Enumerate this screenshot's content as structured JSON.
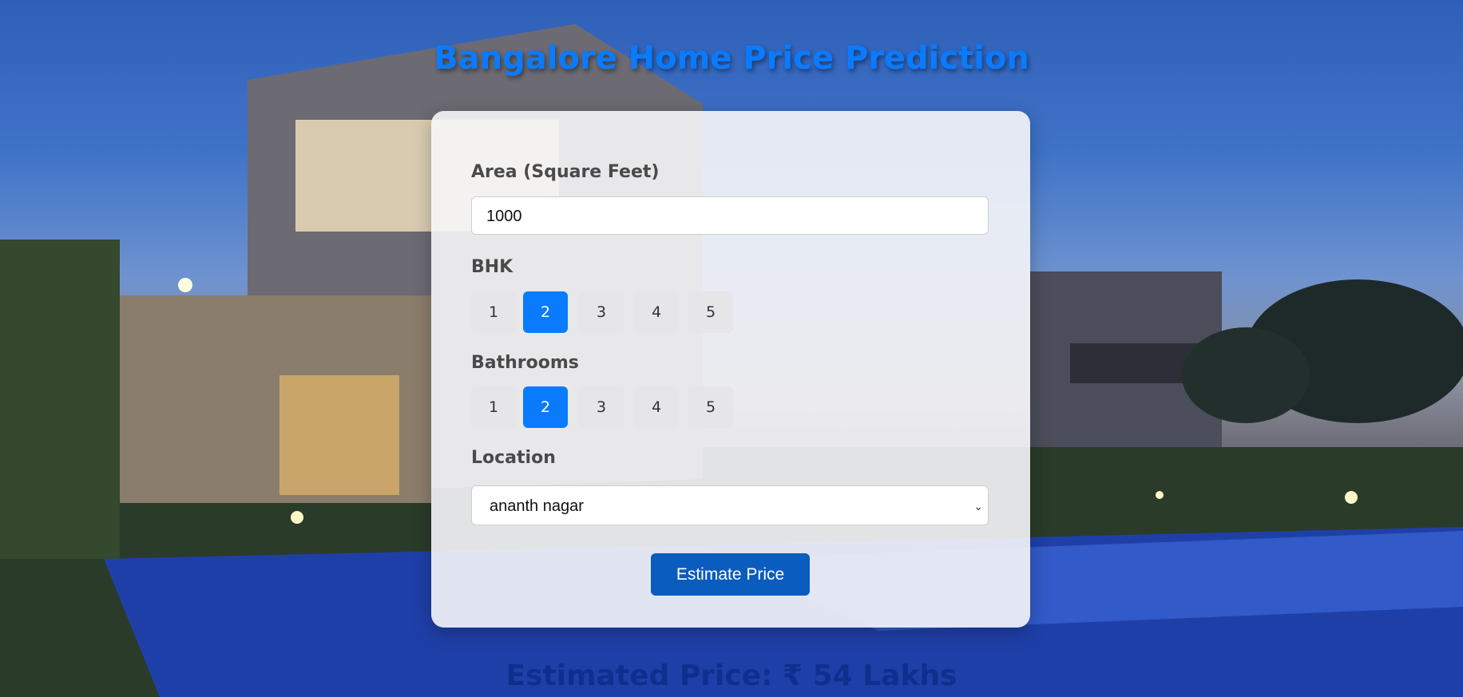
{
  "page": {
    "title": "Bangalore Home Price Prediction"
  },
  "form": {
    "area_label": "Area (Square Feet)",
    "area_value": "1000",
    "bhk_label": "BHK",
    "bhk_options": [
      "1",
      "2",
      "3",
      "4",
      "5"
    ],
    "bhk_selected": "2",
    "bath_label": "Bathrooms",
    "bath_options": [
      "1",
      "2",
      "3",
      "4",
      "5"
    ],
    "bath_selected": "2",
    "location_label": "Location",
    "location_value": "ananth nagar",
    "estimate_label": "Estimate Price"
  },
  "result": {
    "text": "Estimated Price: ₹ 54 Lakhs"
  },
  "colors": {
    "accent": "#0a7bff",
    "button": "#0a5cbf",
    "result": "#0f2f8f"
  },
  "icons": {
    "select_caret": "chevron-down-icon"
  }
}
